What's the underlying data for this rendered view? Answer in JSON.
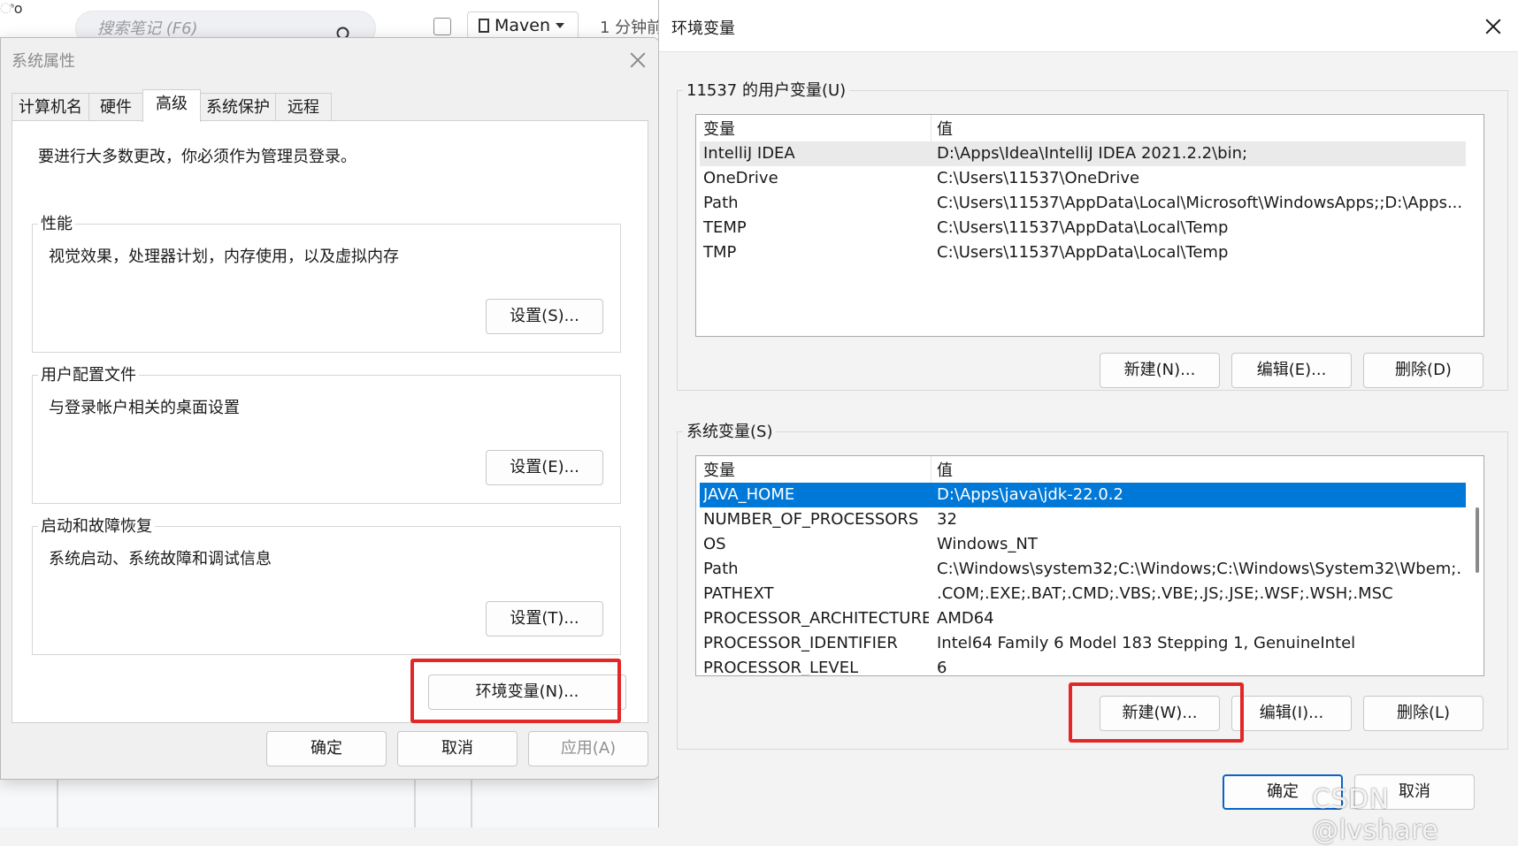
{
  "background": {
    "search_placeholder": "搜索笔记 (F6)",
    "maven_label": "Maven",
    "time_label": "1 分钟前",
    "left_edge_text": "ಿo"
  },
  "system_properties": {
    "title": "系统属性",
    "tabs": [
      {
        "label": "计算机名",
        "active": false
      },
      {
        "label": "硬件",
        "active": false
      },
      {
        "label": "高级",
        "active": true
      },
      {
        "label": "系统保护",
        "active": false
      },
      {
        "label": "远程",
        "active": false
      }
    ],
    "admin_notice": "要进行大多数更改，你必须作为管理员登录。",
    "groups": [
      {
        "label": "性能",
        "description": "视觉效果，处理器计划，内存使用，以及虚拟内存",
        "button": "设置(S)..."
      },
      {
        "label": "用户配置文件",
        "description": "与登录帐户相关的桌面设置",
        "button": "设置(E)..."
      },
      {
        "label": "启动和故障恢复",
        "description": "系统启动、系统故障和调试信息",
        "button": "设置(T)..."
      }
    ],
    "env_button": "环境变量(N)...",
    "footer": {
      "ok": "确定",
      "cancel": "取消",
      "apply": "应用(A)"
    }
  },
  "env_vars": {
    "title": "环境变量",
    "user_section": {
      "label": "11537 的用户变量(U)",
      "columns": [
        "变量",
        "值"
      ],
      "rows": [
        {
          "name": "IntelliJ IDEA",
          "value": "D:\\Apps\\Idea\\IntelliJ IDEA 2021.2.2\\bin;"
        },
        {
          "name": "OneDrive",
          "value": "C:\\Users\\11537\\OneDrive"
        },
        {
          "name": "Path",
          "value": "C:\\Users\\11537\\AppData\\Local\\Microsoft\\WindowsApps;;D:\\Apps..."
        },
        {
          "name": "TEMP",
          "value": "C:\\Users\\11537\\AppData\\Local\\Temp"
        },
        {
          "name": "TMP",
          "value": "C:\\Users\\11537\\AppData\\Local\\Temp"
        }
      ],
      "buttons": {
        "new": "新建(N)...",
        "edit": "编辑(E)...",
        "delete": "删除(D)"
      }
    },
    "system_section": {
      "label": "系统变量(S)",
      "columns": [
        "变量",
        "值"
      ],
      "rows": [
        {
          "name": "JAVA_HOME",
          "value": "D:\\Apps\\java\\jdk-22.0.2"
        },
        {
          "name": "NUMBER_OF_PROCESSORS",
          "value": "32"
        },
        {
          "name": "OS",
          "value": "Windows_NT"
        },
        {
          "name": "Path",
          "value": "C:\\Windows\\system32;C:\\Windows;C:\\Windows\\System32\\Wbem;..."
        },
        {
          "name": "PATHEXT",
          "value": ".COM;.EXE;.BAT;.CMD;.VBS;.VBE;.JS;.JSE;.WSF;.WSH;.MSC"
        },
        {
          "name": "PROCESSOR_ARCHITECTURE",
          "value": "AMD64"
        },
        {
          "name": "PROCESSOR_IDENTIFIER",
          "value": "Intel64 Family 6 Model 183 Stepping 1, GenuineIntel"
        },
        {
          "name": "PROCESSOR_LEVEL",
          "value": "6"
        }
      ],
      "buttons": {
        "new": "新建(W)...",
        "edit": "编辑(I)...",
        "delete": "删除(L)"
      }
    },
    "footer": {
      "ok": "确定",
      "cancel": "取消"
    }
  },
  "watermark": "CSDN @lvshare",
  "colors": {
    "highlight": "#e12727",
    "selection": "#0078d7",
    "primary_border": "#0a63c9"
  }
}
